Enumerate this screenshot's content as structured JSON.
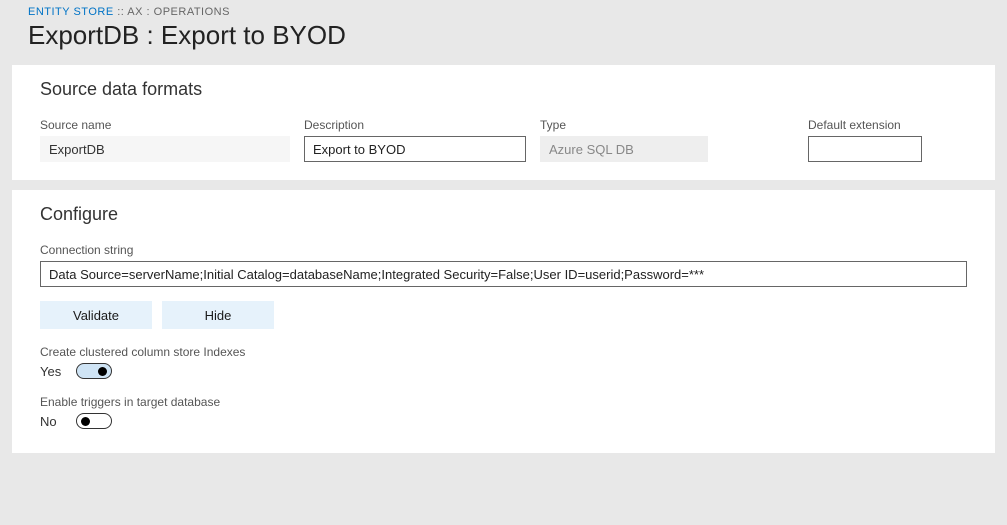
{
  "breadcrumb": {
    "link": "ENTITY STORE",
    "sep": " :: ",
    "rest": "AX : OPERATIONS"
  },
  "pageTitle": "ExportDB : Export to BYOD",
  "sourcePanel": {
    "header": "Source data formats",
    "sourceName": {
      "label": "Source name",
      "value": "ExportDB"
    },
    "description": {
      "label": "Description",
      "value": "Export to BYOD"
    },
    "type": {
      "label": "Type",
      "value": "Azure SQL DB"
    },
    "defaultExt": {
      "label": "Default extension",
      "value": ""
    }
  },
  "configurePanel": {
    "header": "Configure",
    "connString": {
      "label": "Connection string",
      "value": "Data Source=serverName;Initial Catalog=databaseName;Integrated Security=False;User ID=userid;Password=***"
    },
    "buttons": {
      "validate": "Validate",
      "hide": "Hide"
    },
    "toggle1": {
      "caption": "Create clustered column store Indexes",
      "value": "Yes",
      "on": true
    },
    "toggle2": {
      "caption": "Enable triggers in target database",
      "value": "No",
      "on": false
    }
  }
}
